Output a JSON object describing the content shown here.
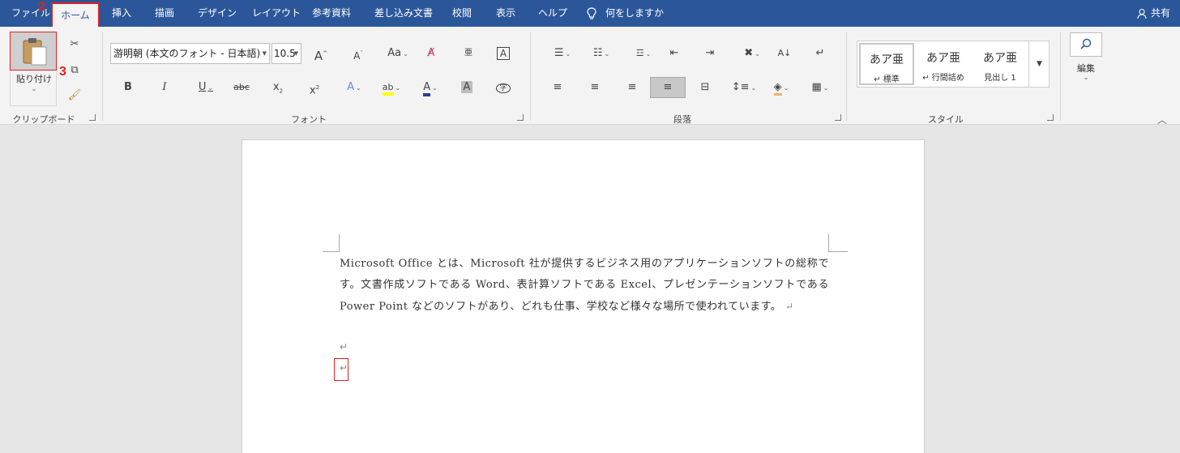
{
  "tabs": {
    "file": "ファイル",
    "home": "ホーム",
    "insert": "挿入",
    "draw": "描画",
    "design": "デザイン",
    "layout": "レイアウト",
    "references": "参考資料",
    "mailings": "差し込み文書",
    "review": "校閲",
    "view": "表示",
    "help": "ヘルプ",
    "tell_me": "何をしますか",
    "share": "共有"
  },
  "clipboard": {
    "paste_label": "貼り付け",
    "group_label": "クリップボード"
  },
  "font": {
    "name": "游明朝 (本文のフォント - 日本語)",
    "size": "10.5",
    "group_label": "フォント"
  },
  "paragraph": {
    "group_label": "段落"
  },
  "styles": {
    "items": [
      {
        "sample": "あア亜",
        "name": "↵ 標準"
      },
      {
        "sample": "あア亜",
        "name": "↵ 行間詰め"
      },
      {
        "sample": "あア亜",
        "name": "見出し 1"
      }
    ],
    "group_label": "スタイル"
  },
  "editing": {
    "label": "編集"
  },
  "annotations": {
    "one": "1",
    "two": "2",
    "three": "3"
  },
  "document": {
    "paragraph": "Microsoft Office とは、Microsoft 社が提供するビジネス用のアプリケーションソフトの総称です。文書作成ソフトである Word、表計算ソフトである Excel、プレゼンテーションソフトである Power Point などのソフトがあり、どれも仕事、学校など様々な場所で使われています。",
    "para_mark": "↵"
  }
}
